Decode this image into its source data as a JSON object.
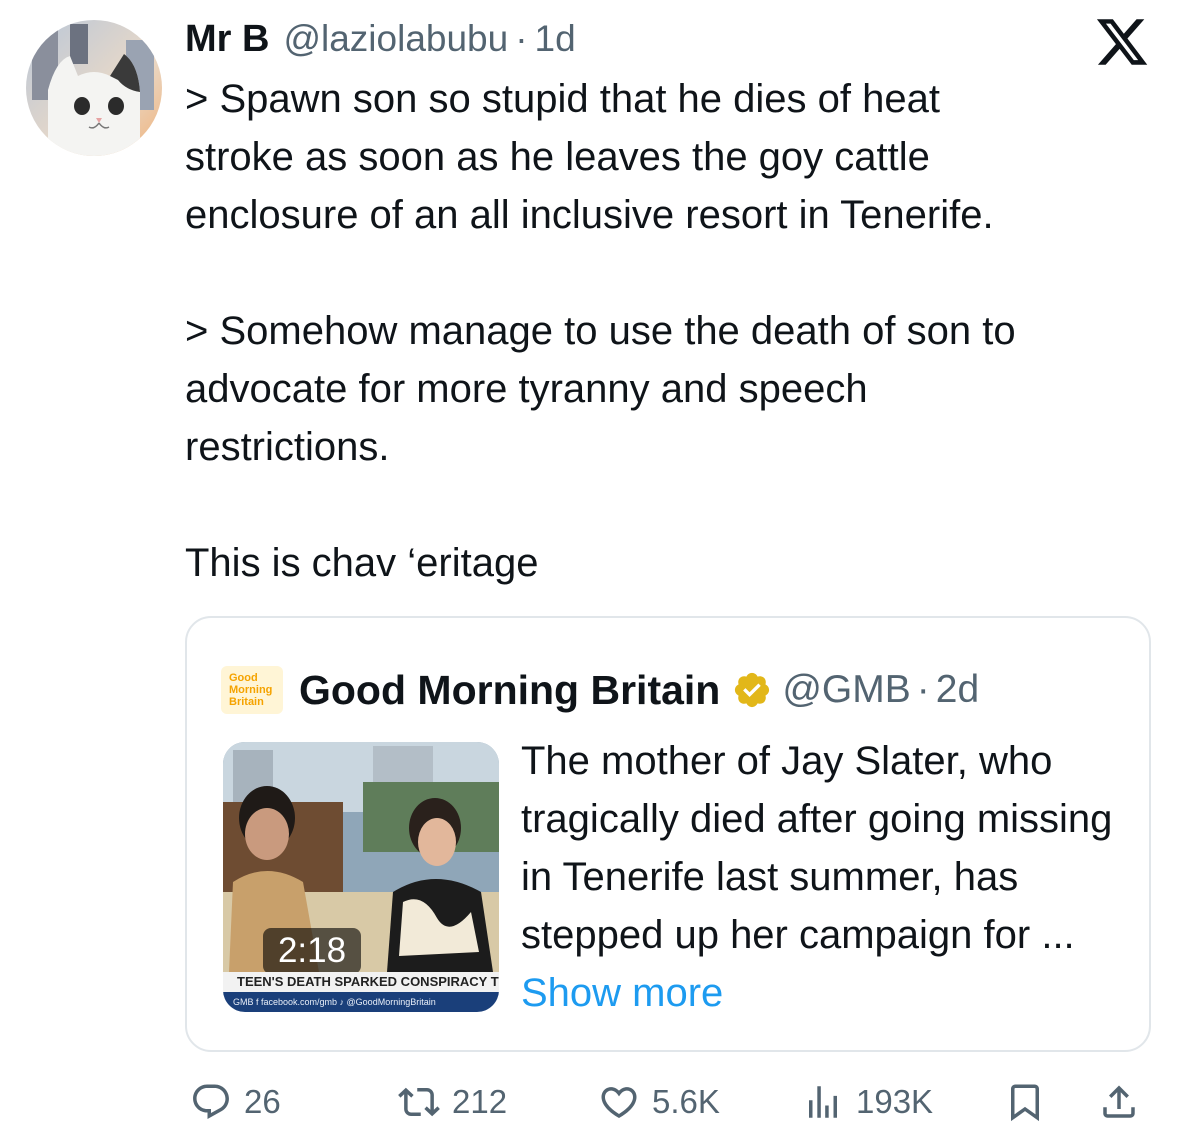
{
  "tweet": {
    "author_name": "Mr B",
    "author_handle": "@laziolabubu",
    "separator": "·",
    "time": "1d",
    "text_lines": [
      "> Spawn son so stupid that he dies of heat",
      "stroke as soon as he leaves the goy cattle",
      "enclosure of an all inclusive resort in Tenerife.",
      "> Somehow manage to use the death of son to",
      "advocate for more tyranny and speech",
      "restrictions.",
      "This is chav ‘eritage"
    ]
  },
  "quote": {
    "logo_lines": [
      "Good",
      "Morning",
      "Britain"
    ],
    "author_name": "Good Morning Britain",
    "author_handle": "@GMB",
    "separator": "·",
    "time": "2d",
    "video_duration": "2:18",
    "video_chyron": "TEEN'S DEATH SPARKED CONSPIRACY THEO",
    "video_ticker": "GMB   f facebook.com/gmb   ♪ @GoodMorningBritain",
    "text": "The mother of Jay Slater, who tragically died after going missing in Tenerife last summer, has stepped up her campaign for ...",
    "show_more": "Show more"
  },
  "actions": {
    "replies": "26",
    "reposts": "212",
    "likes": "5.6K",
    "views": "193K"
  },
  "icons": {
    "platform": "x-logo-icon",
    "verified": "verified-badge-icon",
    "reply": "reply-icon",
    "repost": "repost-icon",
    "like": "like-icon",
    "views": "views-icon",
    "bookmark": "bookmark-icon",
    "share": "share-icon"
  },
  "colors": {
    "text": "#0f1419",
    "secondary": "#536471",
    "link": "#1d9bf0",
    "border": "#e1e6ea",
    "verified_gold": "#e2b719"
  }
}
